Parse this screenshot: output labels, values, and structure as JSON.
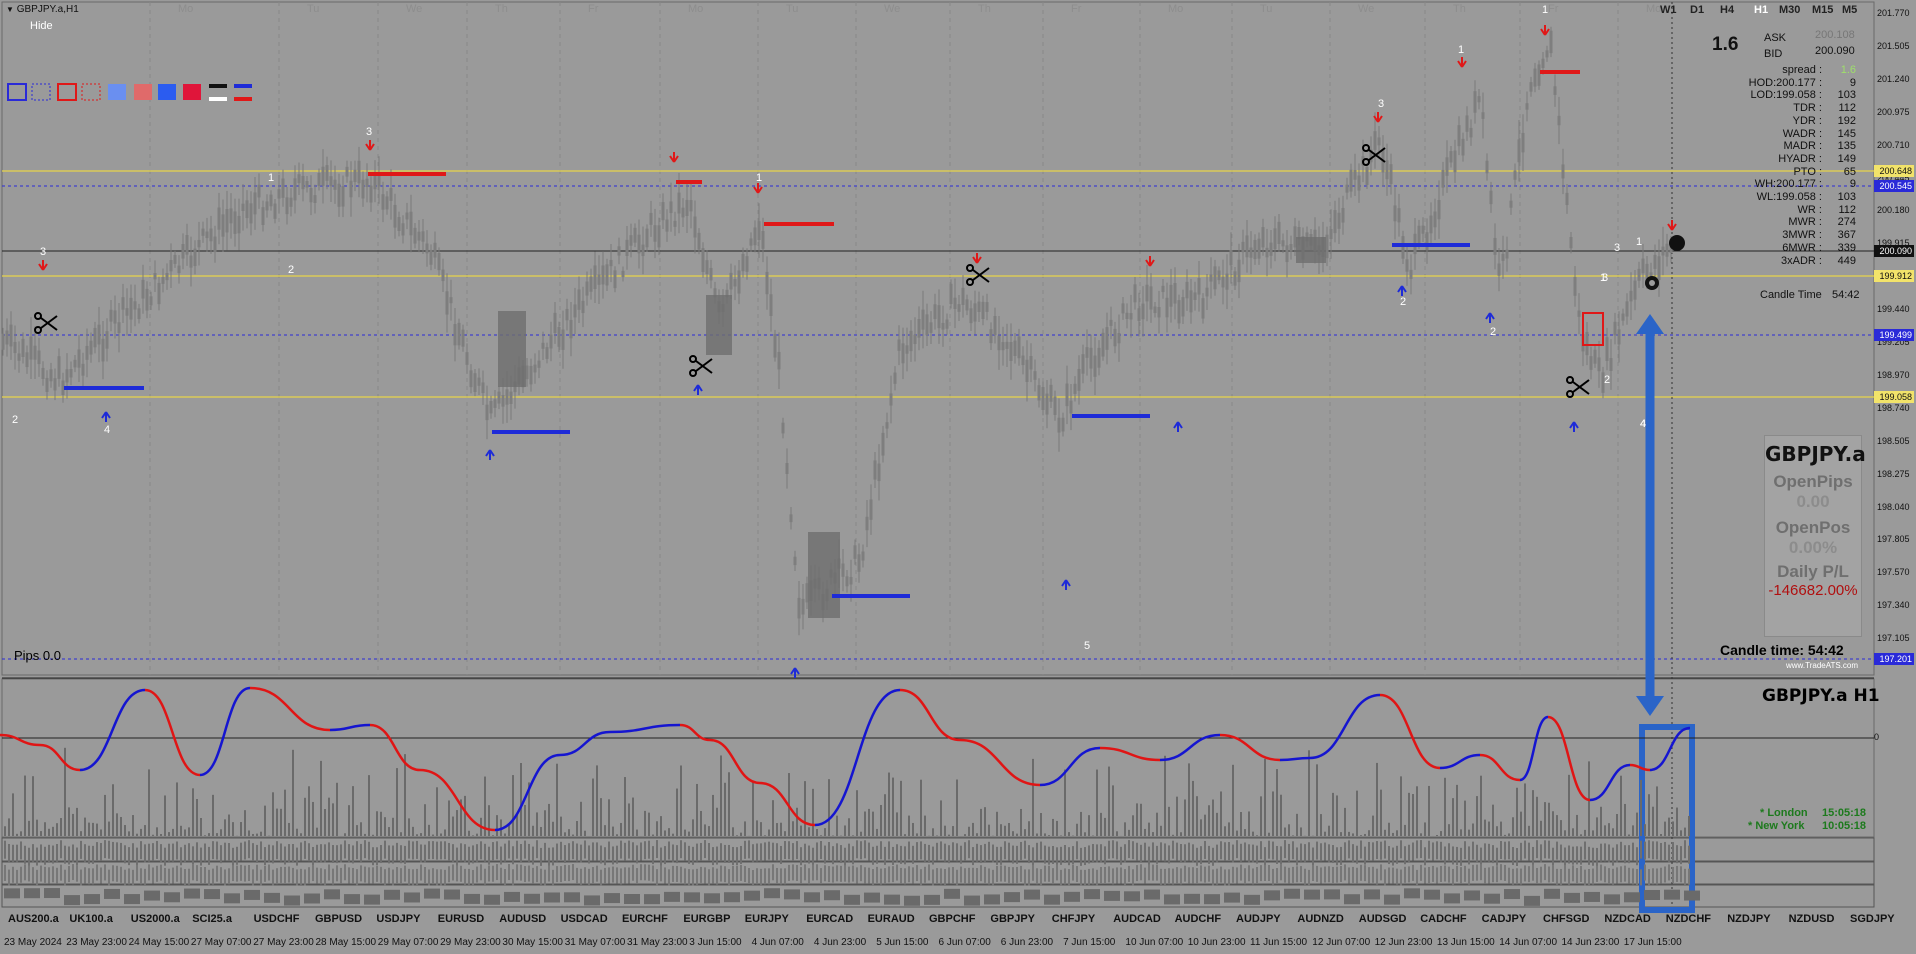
{
  "window": {
    "title": "GBPJPY.a,H1",
    "hide_label": "Hide"
  },
  "timeframes": [
    {
      "label": "W1",
      "active": false
    },
    {
      "label": "D1",
      "active": false
    },
    {
      "label": "H4",
      "active": false
    },
    {
      "label": "H1",
      "active": true
    },
    {
      "label": "M30",
      "active": false
    },
    {
      "label": "M15",
      "active": false
    },
    {
      "label": "M5",
      "active": false
    }
  ],
  "day_labels": [
    "Mo",
    "Tu",
    "We",
    "Th",
    "Fr",
    "Mo",
    "Tu",
    "We",
    "Th",
    "Fr",
    "Mo",
    "Tu",
    "We",
    "Th",
    "Fr",
    "Mo"
  ],
  "spread_panel": {
    "big_value": "1.6",
    "ask_label": "ASK",
    "ask_value": "200.108",
    "bid_label": "BID",
    "bid_value": "200.090",
    "rows": [
      {
        "label": "spread :",
        "value": "1.6"
      },
      {
        "label": "HOD:200.177 :",
        "value": "9"
      },
      {
        "label": "LOD:199.058 :",
        "value": "103"
      },
      {
        "label": "TDR :",
        "value": "112"
      },
      {
        "label": "YDR :",
        "value": "192"
      },
      {
        "label": "WADR :",
        "value": "145"
      },
      {
        "label": "MADR :",
        "value": "135"
      },
      {
        "label": "HYADR :",
        "value": "149"
      },
      {
        "label": "PTO :",
        "value": "65"
      },
      {
        "label": "WH:200.177 :",
        "value": "9"
      },
      {
        "label": "WL:199.058 :",
        "value": "103"
      },
      {
        "label": "WR :",
        "value": "112"
      },
      {
        "label": "MWR :",
        "value": "274"
      },
      {
        "label": "3MWR :",
        "value": "367"
      },
      {
        "label": "6MWR :",
        "value": "339"
      },
      {
        "label": "3xADR :",
        "value": "449"
      }
    ],
    "candle_time_label": "Candle Time",
    "candle_time_value": "54:42"
  },
  "price_axis": [
    "201.770",
    "201.505",
    "201.240",
    "200.975",
    "200.710",
    "200.445",
    "200.180",
    "199.915",
    "199.670",
    "199.440",
    "199.205",
    "198.970",
    "198.740",
    "198.505",
    "198.275",
    "198.040",
    "197.805",
    "197.570",
    "197.340",
    "197.105"
  ],
  "price_tags": [
    {
      "value": "200.648",
      "color": "#f2e36a"
    },
    {
      "value": "200.545",
      "color": "#2a2ad8"
    },
    {
      "value": "200.090",
      "color": "#111111"
    },
    {
      "value": "199.912",
      "color": "#f2e36a"
    },
    {
      "value": "199.499",
      "color": "#2a2ad8"
    },
    {
      "value": "199.058",
      "color": "#f2e36a"
    },
    {
      "value": "197.201",
      "color": "#2a2ad8"
    }
  ],
  "info_box": {
    "symbol": "GBPJPY.a",
    "open_pips_label": "OpenPips",
    "open_pips_value": "0.00",
    "open_pos_label": "OpenPos",
    "open_pos_value": "0.00%",
    "daily_pl_label": "Daily P/L",
    "daily_pl_value": "-146682.00%"
  },
  "candle_time_footer": "Candle time:  54:42",
  "pips_label": "Pips 0.0",
  "watermark": "www.TradeATS.com",
  "wave_labels": [
    "3",
    "1",
    "2",
    "3",
    "4",
    "2",
    "1",
    "3",
    "1",
    "1",
    "3",
    "2",
    "5",
    "3",
    "1",
    "2",
    "4",
    "4",
    "1",
    "2"
  ],
  "oscillator": {
    "title": "GBPJPY.a  H1",
    "zero_label": "0",
    "sessions": [
      {
        "name": "* London",
        "time": "15:05:18"
      },
      {
        "name": "* New York",
        "time": "10:05:18"
      }
    ]
  },
  "symbol_tabs": [
    "AUS200.a",
    "UK100.a",
    "US2000.a",
    "SCI25.a",
    "USDCHF",
    "GBPUSD",
    "USDJPY",
    "EURUSD",
    "AUDUSD",
    "USDCAD",
    "EURCHF",
    "EURGBP",
    "EURJPY",
    "EURCAD",
    "EURAUD",
    "GBPCHF",
    "GBPJPY",
    "CHFJPY",
    "AUDCAD",
    "AUDCHF",
    "AUDJPY",
    "AUDNZD",
    "AUDSGD",
    "CADCHF",
    "CADJPY",
    "CHFSGD",
    "NZDCAD",
    "NZDCHF",
    "NZDJPY",
    "NZDUSD",
    "SGDJPY"
  ],
  "time_axis": [
    "23 May 2024",
    "23 May 23:00",
    "24 May 15:00",
    "27 May 07:00",
    "27 May 23:00",
    "28 May 15:00",
    "29 May 07:00",
    "29 May 23:00",
    "30 May 15:00",
    "31 May 07:00",
    "31 May 23:00",
    "3 Jun 15:00",
    "4 Jun 07:00",
    "4 Jun 23:00",
    "5 Jun 15:00",
    "6 Jun 07:00",
    "6 Jun 23:00",
    "7 Jun 15:00",
    "10 Jun 07:00",
    "10 Jun 23:00",
    "11 Jun 15:00",
    "12 Jun 07:00",
    "12 Jun 23:00",
    "13 Jun 15:00",
    "14 Jun 07:00",
    "14 Jun 23:00",
    "17 Jun 15:00"
  ],
  "colors": {
    "background": "#9a9a9a",
    "candle": "#7e7e7e",
    "support": "#1e2bd8",
    "resistance": "#e01818",
    "yellow_level": "#e6d44a",
    "blue_level": "#2a2ad8",
    "annotation": "#2a64c8",
    "osc_up": "#1515d0",
    "osc_down": "#e01515"
  },
  "icons": [
    "scissors-icon",
    "down-arrow-marker",
    "up-arrow-marker",
    "double-headed-arrow",
    "rectangle-tool-icon"
  ]
}
